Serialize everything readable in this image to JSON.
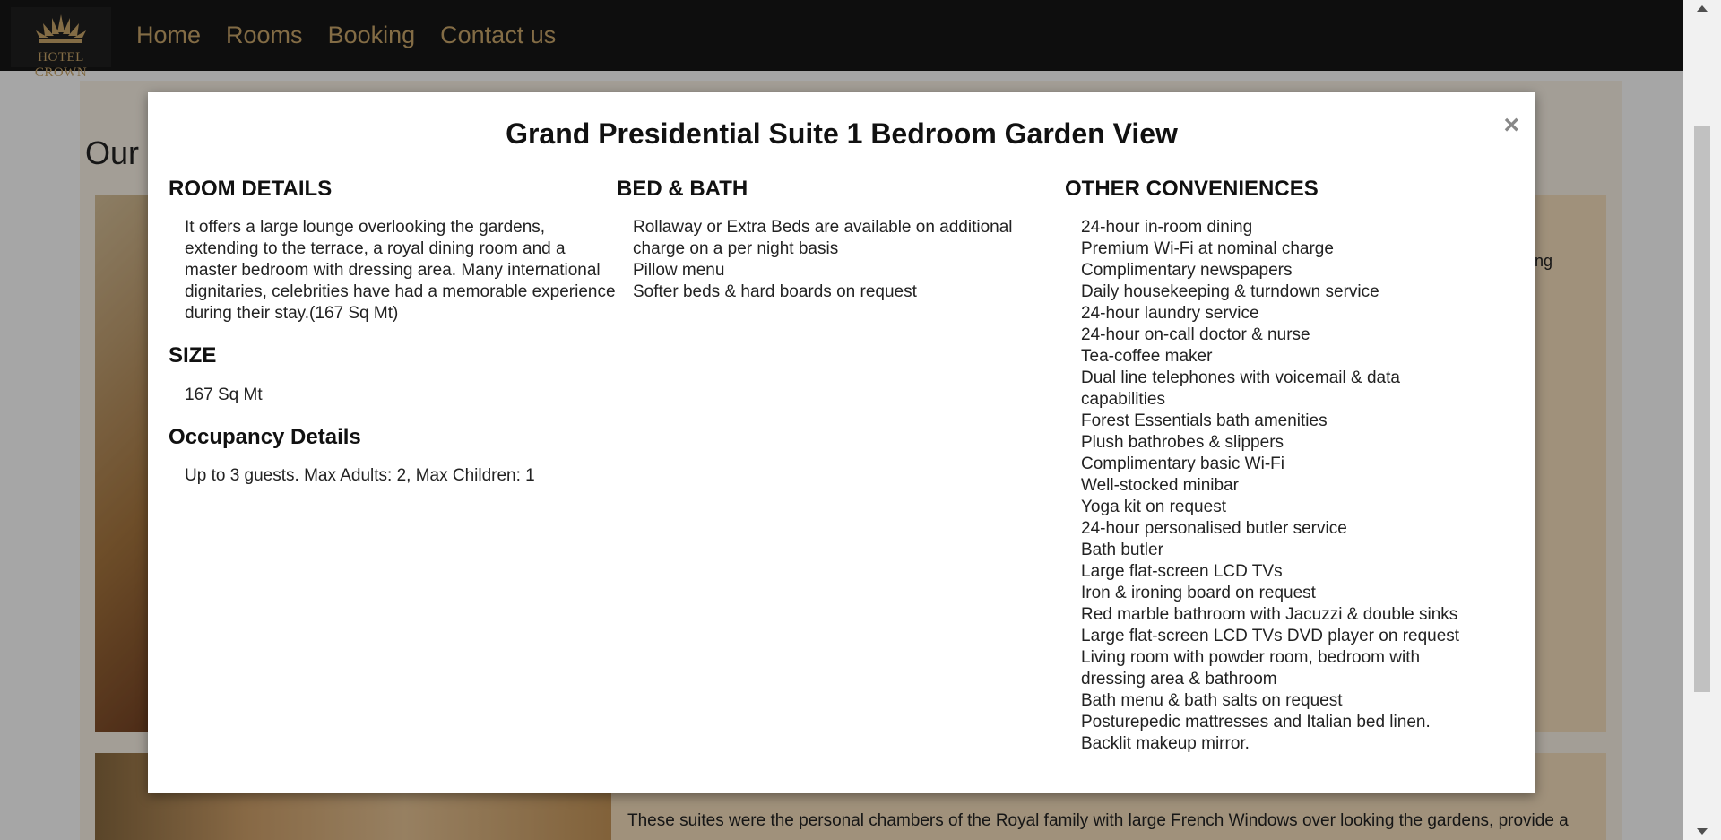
{
  "navbar": {
    "logo_text": "HOTEL CROWN",
    "links": [
      "Home",
      "Rooms",
      "Booking",
      "Contact us"
    ]
  },
  "page": {
    "section_heading": "Our",
    "card1_peek": "ng",
    "card2_text": "These suites were the personal chambers of the Royal family with large French Windows over looking the gardens, provide a"
  },
  "modal": {
    "title": "Grand Presidential Suite 1 Bedroom Garden View",
    "close_label": "×",
    "room_details": {
      "heading": "ROOM DETAILS",
      "text": "It offers a large lounge overlooking the gardens, extending to the terrace, a royal dining room and a master bedroom with dressing area. Many international dignitaries, celebrities have had a memorable experience during their stay.(167 Sq Mt)"
    },
    "size": {
      "heading": "SIZE",
      "text": "167 Sq Mt"
    },
    "occupancy": {
      "heading": "Occupancy Details",
      "text": "Up to 3 guests. Max Adults: 2, Max Children: 1"
    },
    "bed_bath": {
      "heading": "BED & BATH",
      "items": [
        "Rollaway or Extra Beds are available on additional charge on a per night basis",
        "Pillow menu",
        "Softer beds & hard boards on request"
      ]
    },
    "other": {
      "heading": "OTHER CONVENIENCES",
      "items": [
        "24-hour in-room dining",
        "Premium Wi-Fi at nominal charge",
        "Complimentary newspapers",
        "Daily housekeeping & turndown service",
        "24-hour laundry service",
        "24-hour on-call doctor & nurse",
        "Tea-coffee maker",
        "Dual line telephones with voicemail & data capabilities",
        "Forest Essentials bath amenities",
        "Plush bathrobes & slippers",
        "Complimentary basic Wi-Fi",
        "Well-stocked minibar",
        "Yoga kit on request",
        "24-hour personalised butler service",
        "Bath butler",
        "Large flat-screen LCD TVs",
        "Iron & ironing board on request",
        "Red marble bathroom with Jacuzzi & double sinks",
        "Large flat-screen LCD TVs DVD player on request",
        "Living room with powder room, bedroom with dressing area & bathroom",
        "Bath menu & bath salts on request",
        "Posturepedic mattresses and Italian bed linen.",
        "Backlit makeup mirror."
      ]
    }
  },
  "colors": {
    "navbar_bg": "#161616",
    "nav_link": "#c9a66b",
    "card_bg": "#f6dfbd",
    "overlay": "rgba(0,0,0,0.35)"
  },
  "icons": {
    "logo": "crown-logo-icon",
    "close": "close-icon"
  }
}
